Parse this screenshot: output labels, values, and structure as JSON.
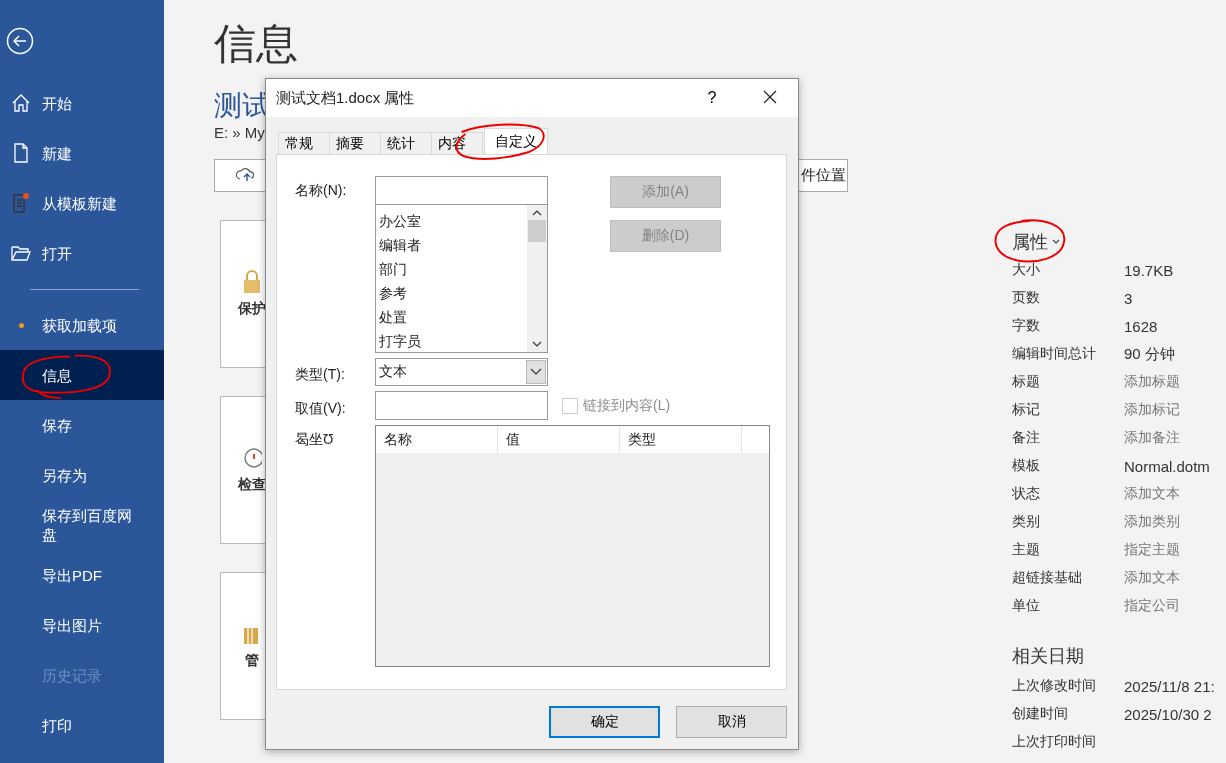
{
  "sidebar": {
    "groups": [
      [
        {
          "label": "开始",
          "selected": false,
          "disabled": false
        },
        {
          "label": "新建",
          "selected": false,
          "disabled": false
        },
        {
          "label": "从模板新建",
          "selected": false,
          "disabled": false
        },
        {
          "label": "打开",
          "selected": false,
          "disabled": false
        }
      ],
      [
        {
          "label": "获取加载项",
          "selected": false,
          "disabled": false,
          "has_update": true
        },
        {
          "label": "信息",
          "selected": true,
          "disabled": false,
          "circled": true
        },
        {
          "label": "保存",
          "selected": false,
          "disabled": false
        },
        {
          "label": "另存为",
          "selected": false,
          "disabled": false
        },
        {
          "label": "保存到百度网盘",
          "selected": false,
          "disabled": false
        },
        {
          "label": "导出PDF",
          "selected": false,
          "disabled": false
        },
        {
          "label": "导出图片",
          "selected": false,
          "disabled": false
        },
        {
          "label": "历史记录",
          "selected": false,
          "disabled": true
        },
        {
          "label": "打印",
          "selected": false,
          "disabled": false
        }
      ]
    ]
  },
  "page": {
    "title": "信息",
    "document_title": "测试",
    "path": "E: » My",
    "right_button": "件位置",
    "cards": [
      {
        "label": "保护"
      },
      {
        "label": "检查"
      },
      {
        "label": "管"
      }
    ]
  },
  "properties": {
    "heading": "属性",
    "circled": true,
    "rows": [
      {
        "label": "大小",
        "value": "19.7KB",
        "kind": "value"
      },
      {
        "label": "页数",
        "value": "3",
        "kind": "value"
      },
      {
        "label": "字数",
        "value": "1628",
        "kind": "value"
      },
      {
        "label": "编辑时间总计",
        "value": "90 分钟",
        "kind": "value"
      },
      {
        "label": "标题",
        "value": "添加标题",
        "kind": "prompt"
      },
      {
        "label": "标记",
        "value": "添加标记",
        "kind": "prompt"
      },
      {
        "label": "备注",
        "value": "添加备注",
        "kind": "prompt"
      },
      {
        "label": "模板",
        "value": "Normal.dotm",
        "kind": "value"
      },
      {
        "label": "状态",
        "value": "添加文本",
        "kind": "prompt"
      },
      {
        "label": "类别",
        "value": "添加类别",
        "kind": "prompt"
      },
      {
        "label": "主题",
        "value": "指定主题",
        "kind": "prompt"
      },
      {
        "label": "超链接基础",
        "value": "添加文本",
        "kind": "prompt"
      },
      {
        "label": "单位",
        "value": "指定公司",
        "kind": "prompt"
      }
    ]
  },
  "related_dates": {
    "heading": "相关日期",
    "rows": [
      {
        "label": "上次修改时间",
        "value": "2025/11/8 21:"
      },
      {
        "label": "创建时间",
        "value": "2025/10/30 2"
      },
      {
        "label": "上次打印时间"
      }
    ]
  },
  "dialog": {
    "title": "测试文档1.docx 属性",
    "help": "?",
    "tabs": [
      {
        "label": "常规",
        "selected": false
      },
      {
        "label": "摘要",
        "selected": false
      },
      {
        "label": "统计",
        "selected": false
      },
      {
        "label": "内容",
        "selected": false
      },
      {
        "label": "自定义",
        "selected": true,
        "circled": true
      }
    ],
    "name_label": "名称(N):",
    "name_options": [
      "办公室",
      "编辑者",
      "部门",
      "参考",
      "处置",
      "打字员"
    ],
    "add_button": {
      "label": "添加(A)",
      "disabled": true
    },
    "delete_button": {
      "label": "删除(D)",
      "disabled": true
    },
    "type_label": "类型(T):",
    "type_value": "文本",
    "value_label": "取值(V):",
    "link_checkbox": {
      "label": "链接到内容(L)",
      "checked": false,
      "disabled": true
    },
    "properties_label": "曷坐Ʊ",
    "columns": [
      "名称",
      "值",
      "类型"
    ],
    "ok_button": "确定",
    "cancel_button": "取消"
  }
}
